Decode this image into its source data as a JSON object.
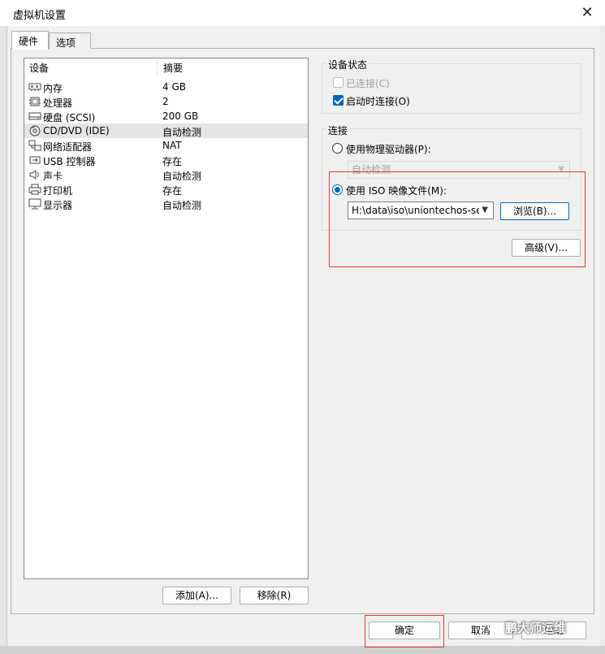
{
  "window": {
    "title": "虚拟机设置",
    "close_glyph": "✕"
  },
  "tabs": [
    {
      "label": "硬件"
    },
    {
      "label": "选项"
    }
  ],
  "device_list": {
    "headers": {
      "device": "设备",
      "summary": "摘要"
    },
    "rows": [
      {
        "icon": "memory-icon",
        "name": "内存",
        "summary": "4 GB"
      },
      {
        "icon": "cpu-icon",
        "name": "处理器",
        "summary": "2"
      },
      {
        "icon": "harddisk-icon",
        "name": "硬盘 (SCSI)",
        "summary": "200 GB"
      },
      {
        "icon": "cd-dvd-icon",
        "name": "CD/DVD (IDE)",
        "summary": "自动检测"
      },
      {
        "icon": "network-adapter-icon",
        "name": "网络适配器",
        "summary": "NAT"
      },
      {
        "icon": "usb-icon",
        "name": "USB 控制器",
        "summary": "存在"
      },
      {
        "icon": "speaker-icon",
        "name": "声卡",
        "summary": "自动检测"
      },
      {
        "icon": "printer-icon",
        "name": "打印机",
        "summary": "存在"
      },
      {
        "icon": "monitor-icon",
        "name": "显示器",
        "summary": "自动检测"
      }
    ],
    "selected_index": 3
  },
  "buttons": {
    "add": "添加(A)...",
    "remove": "移除(R)",
    "ok": "确定",
    "cancel": "取消",
    "help": "帮助"
  },
  "device_status": {
    "label": "设备状态",
    "connected": {
      "label": "已连接(C)",
      "checked": false,
      "disabled": true
    },
    "connect_at_power_on": {
      "label": "启动时连接(O)",
      "checked": true
    }
  },
  "connection": {
    "label": "连接",
    "physical_drive": {
      "label": "使用物理驱动器(P):",
      "selected": false,
      "dropdown_value": "自动检测"
    },
    "iso_image": {
      "label": "使用 ISO 映像文件(M):",
      "selected": true,
      "path_value": "H:\\data\\iso\\uniontechos-ser",
      "browse_label": "浏览(B)..."
    },
    "advanced_label": "高级(V)..."
  },
  "watermark": {
    "text": "鹏大师运维"
  },
  "colors": {
    "accent": "#0067c0",
    "highlight_box": "#e53935",
    "selected_row": "#e5e5e5"
  }
}
